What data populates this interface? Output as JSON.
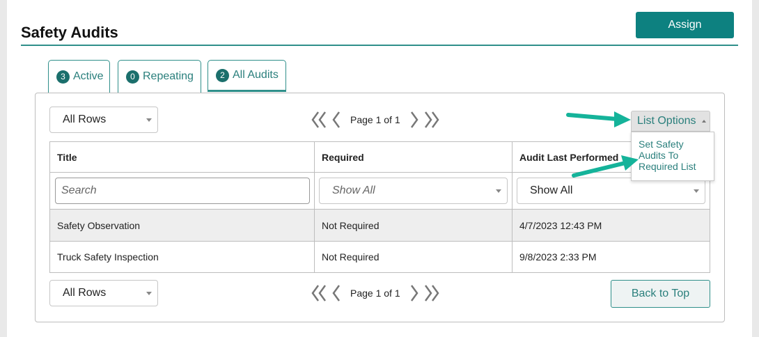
{
  "header": {
    "title": "Safety Audits",
    "assign_label": "Assign"
  },
  "tabs": [
    {
      "count": "3",
      "label": "Active"
    },
    {
      "count": "0",
      "label": "Repeating"
    },
    {
      "count": "2",
      "label": "All Audits"
    }
  ],
  "toolbar": {
    "rows_select": "All Rows",
    "page_label": "Page 1 of 1",
    "list_options_label": "List Options",
    "list_options_menu": [
      "Set Safety",
      "Audits To",
      "Required List"
    ]
  },
  "table": {
    "headers": [
      "Title",
      "Required",
      "Audit Last Performed"
    ],
    "filters": {
      "search_placeholder": "Search",
      "required_filter": "Show All",
      "last_performed_filter": "Show All"
    },
    "rows": [
      [
        "Safety Observation",
        "Not Required",
        "4/7/2023 12:43 PM"
      ],
      [
        "Truck Safety Inspection",
        "Not Required",
        "9/8/2023 2:33 PM"
      ]
    ]
  },
  "footer": {
    "rows_select": "All Rows",
    "page_label": "Page 1 of 1",
    "back_to_top_label": "Back to Top"
  },
  "colors": {
    "teal": "#0d8180",
    "annotation_arrow": "#15b39a"
  }
}
